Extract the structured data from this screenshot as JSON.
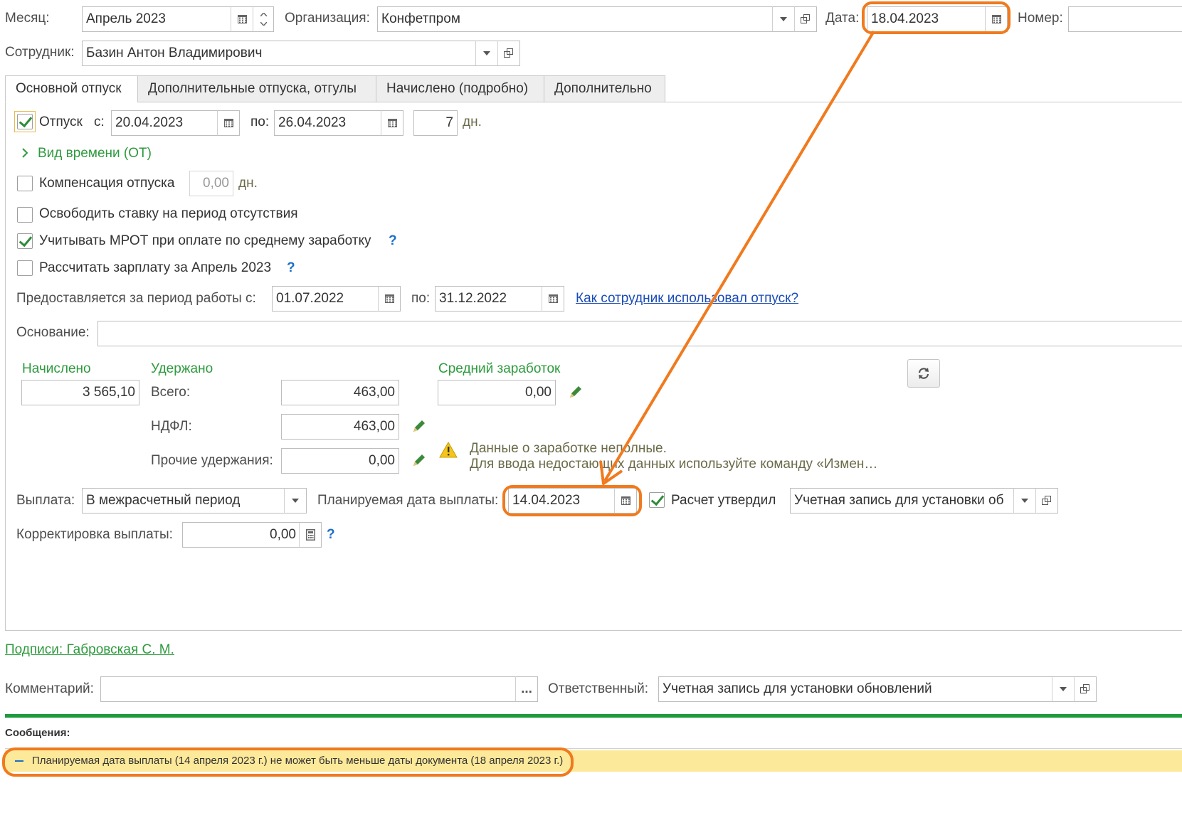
{
  "header": {
    "month_label": "Месяц:",
    "month_value": "Апрель 2023",
    "org_label": "Организация:",
    "org_value": "Конфетпром",
    "date_label": "Дата:",
    "date_value": "18.04.2023",
    "number_label": "Номер:",
    "employee_label": "Сотрудник:",
    "employee_value": "Базин Антон Владимирович"
  },
  "tabs": [
    {
      "label": "Основной отпуск",
      "active": true
    },
    {
      "label": "Дополнительные отпуска, отгулы",
      "active": false
    },
    {
      "label": "Начислено (подробно)",
      "active": false
    },
    {
      "label": "Дополнительно",
      "active": false
    }
  ],
  "vacation": {
    "label": "Отпуск",
    "from_label": "с:",
    "from_value": "20.04.2023",
    "to_label": "по:",
    "to_value": "26.04.2023",
    "days_value": "7",
    "days_unit": "дн.",
    "checked": true
  },
  "time_kind_link": "Вид времени (ОТ)",
  "compensation": {
    "label": "Компенсация отпуска",
    "value": "0,00",
    "unit": "дн.",
    "checked": false
  },
  "release_rate": {
    "label": "Освободить ставку на период отсутствия",
    "checked": false
  },
  "mrot": {
    "label": "Учитывать МРОТ при оплате по среднему заработку",
    "help": "?",
    "checked": true
  },
  "calc_salary": {
    "label": "Рассчитать зарплату за Апрель 2023",
    "help": "?",
    "checked": false
  },
  "period": {
    "label": "Предоставляется за период работы с:",
    "from_value": "01.07.2022",
    "to_label": "по:",
    "to_value": "31.12.2022",
    "link": "Как сотрудник использовал отпуск?"
  },
  "basis": {
    "label": "Основание:",
    "value": ""
  },
  "totals": {
    "accrued_label": "Начислено",
    "accrued_value": "3 565,10",
    "withheld_label": "Удержано",
    "total_label": "Всего:",
    "total_value": "463,00",
    "ndfl_label": "НДФЛ:",
    "ndfl_value": "463,00",
    "other_label": "Прочие удержания:",
    "other_value": "0,00",
    "avg_label": "Средний заработок",
    "avg_value": "0,00"
  },
  "warning": {
    "line1": "Данные о заработке неполные.",
    "line2": "Для ввода недостающих данных используйте команду «Измен…"
  },
  "payment": {
    "label": "Выплата:",
    "value": "В межрасчетный период",
    "planned_label": "Планируемая дата выплаты:",
    "planned_value": "14.04.2023",
    "approved_label": "Расчет утвердил",
    "approved_checked": true,
    "approver_value": "Учетная запись для установки об",
    "correction_label": "Корректировка выплаты:",
    "correction_value": "0,00",
    "correction_help": "?"
  },
  "signatures_link": "Подписи: Габровская С. М.",
  "comment": {
    "label": "Комментарий:",
    "value": "",
    "button": "..."
  },
  "responsible": {
    "label": "Ответственный:",
    "value": "Учетная запись для установки обновлений"
  },
  "messages": {
    "title": "Сообщения:",
    "items": [
      "Планируемая дата выплаты (14 апреля 2023 г.) не может быть меньше даты документа (18 апреля 2023 г.)"
    ]
  },
  "colors": {
    "accent_green": "#2e9a3e",
    "highlight_orange": "#f07a1e",
    "message_bg": "#fde99a",
    "link_blue": "#1a4bb5"
  }
}
